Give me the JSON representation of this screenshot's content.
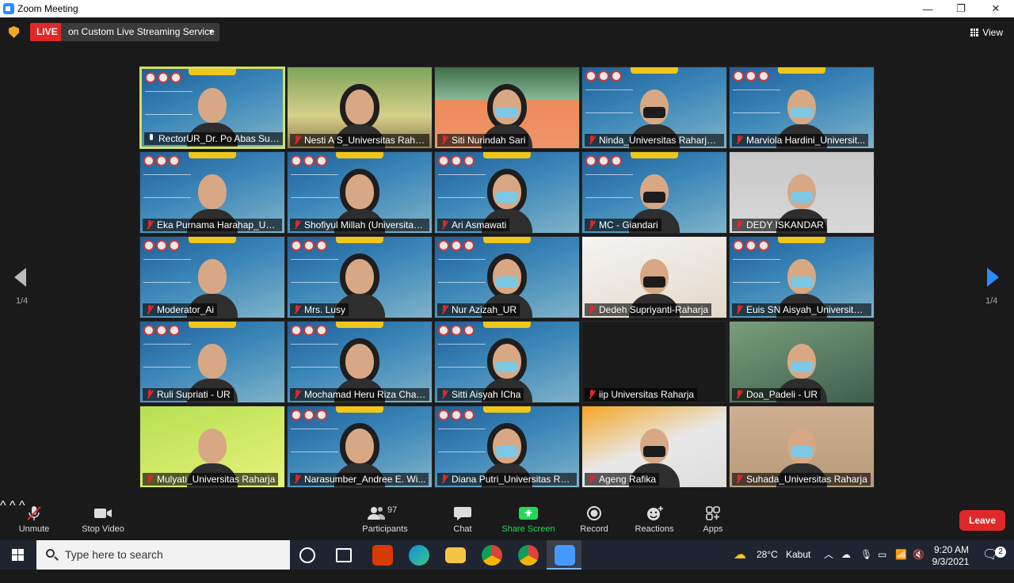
{
  "window": {
    "title": "Zoom Meeting"
  },
  "status": {
    "live_label": "LIVE",
    "live_service": "on Custom Live Streaming Service",
    "view_label": "View"
  },
  "pagination": {
    "left": "1/4",
    "right": "1/4"
  },
  "participants_tiles": [
    {
      "name": "RectorUR_Dr. Po Abas Sun...",
      "mic": "on",
      "bg": "webinar",
      "active": true
    },
    {
      "name": "Nesti A S_Universitas Raha...",
      "mic": "off",
      "bg": "green"
    },
    {
      "name": "Siti Nurindah Sari",
      "mic": "off",
      "bg": "forest"
    },
    {
      "name": "Ninda_Universitas Raharja ...",
      "mic": "off",
      "bg": "webinar"
    },
    {
      "name": "Marviola Hardini_Universit...",
      "mic": "off",
      "bg": "webinar"
    },
    {
      "name": "Eka Purnama Harahap_Uni...",
      "mic": "off",
      "bg": "webinar"
    },
    {
      "name": "Shofiyul Millah (Universitas...",
      "mic": "off",
      "bg": "webinar"
    },
    {
      "name": "Ari Asmawati",
      "mic": "off",
      "bg": "webinar"
    },
    {
      "name": "MC - Giandari",
      "mic": "off",
      "bg": "webinar"
    },
    {
      "name": "DEDY ISKANDAR",
      "mic": "off",
      "bg": "room"
    },
    {
      "name": "Moderator_Ai",
      "mic": "off",
      "bg": "webinar"
    },
    {
      "name": "Mrs. Lusy",
      "mic": "off",
      "bg": "webinar"
    },
    {
      "name": "Nur Azizah_UR",
      "mic": "off",
      "bg": "webinar"
    },
    {
      "name": "Dedeh Supriyanti-Raharja",
      "mic": "off",
      "bg": "white"
    },
    {
      "name": "Euis SN Aisyah_Universitas ...",
      "mic": "off",
      "bg": "webinar"
    },
    {
      "name": "Ruli Supriati - UR",
      "mic": "off",
      "bg": "webinar"
    },
    {
      "name": "Mochamad Heru Riza Chak...",
      "mic": "off",
      "bg": "webinar"
    },
    {
      "name": "Sitti Aisyah ICha",
      "mic": "off",
      "bg": "webinar"
    },
    {
      "name": "iip Universitas Raharja",
      "mic": "off",
      "bg": "dark"
    },
    {
      "name": "Doa_Padeli - UR",
      "mic": "off",
      "bg": "poster"
    },
    {
      "name": "Mulyati_Universitas Raharja",
      "mic": "off",
      "bg": "yellowgreen"
    },
    {
      "name": "Narasumber_Andree E. Wi...",
      "mic": "off",
      "bg": "webinar"
    },
    {
      "name": "Diana Putri_Universitas Rah...",
      "mic": "off",
      "bg": "webinar"
    },
    {
      "name": "Ageng Rafika",
      "mic": "off",
      "bg": "fanta"
    },
    {
      "name": "Suhada_Universitas Raharja",
      "mic": "off",
      "bg": "office"
    }
  ],
  "toolbar": {
    "unmute": "Unmute",
    "stop_video": "Stop Video",
    "participants": "Participants",
    "participants_count": "97",
    "chat": "Chat",
    "share_screen": "Share Screen",
    "record": "Record",
    "reactions": "Reactions",
    "apps": "Apps",
    "leave": "Leave"
  },
  "taskbar": {
    "search_placeholder": "Type here to search",
    "weather_temp": "28°C",
    "weather_desc": "Kabut",
    "time": "9:20 AM",
    "date": "9/3/2021",
    "notification_count": "2"
  },
  "colors": {
    "accent": "#2d8cff",
    "live_red": "#e02828",
    "active_speaker": "#d4e157",
    "share_green": "#23d959"
  }
}
